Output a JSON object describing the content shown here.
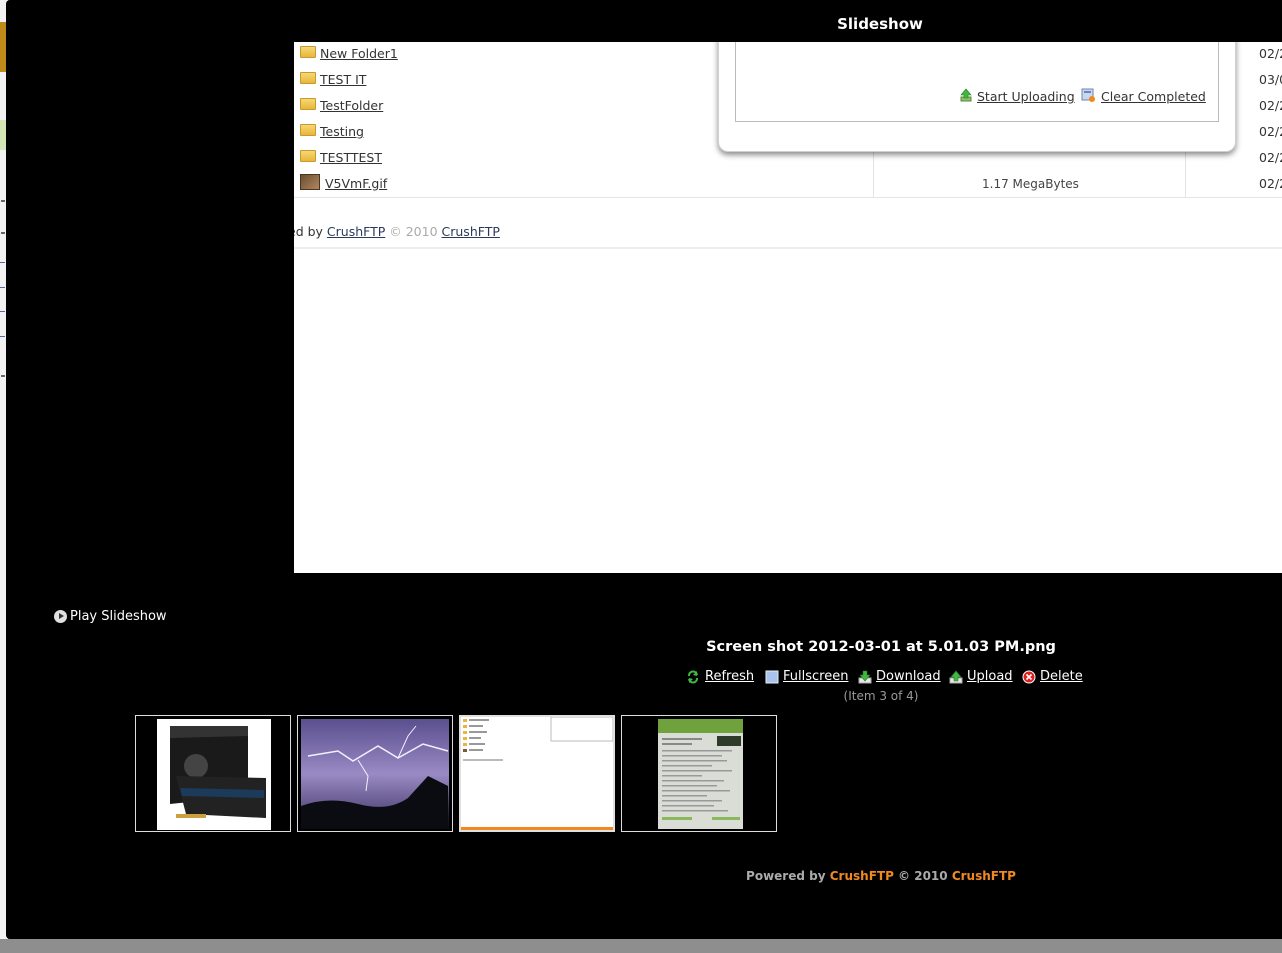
{
  "window": {
    "title": "Slideshow"
  },
  "file_list": [
    {
      "name": "New Folder1",
      "date": "02/2",
      "type": "folder"
    },
    {
      "name": "TEST IT",
      "date": "03/0",
      "type": "folder"
    },
    {
      "name": "TestFolder",
      "date": "02/2",
      "type": "folder"
    },
    {
      "name": "Testing",
      "date": "02/2",
      "type": "folder"
    },
    {
      "name": "TESTTEST",
      "date": "02/2",
      "type": "folder"
    },
    {
      "name": "V5VmF.gif",
      "size": "1.17 MegaBytes",
      "date": "02/2",
      "type": "image"
    }
  ],
  "upload_panel": {
    "start_label": "Start Uploading",
    "clear_label": "Clear Completed"
  },
  "inner_footer": {
    "prefix": "ed by ",
    "link1": "CrushFTP",
    "copy": " © 2010 ",
    "link2": "CrushFTP"
  },
  "slideshow": {
    "play_label": "Play Slideshow",
    "caption": "Screen shot 2012-03-01 at 5.01.03 PM.png",
    "actions": {
      "refresh": "Refresh",
      "fullscreen": "Fullscreen",
      "download": "Download",
      "upload": "Upload",
      "delete": "Delete"
    },
    "item_counter": "(Item 3 of 4)",
    "selected_index": 3,
    "thumbnails": [
      "graphics-card",
      "lightning-sky",
      "screenshot",
      "document-page"
    ]
  },
  "footer": {
    "prefix": "Powered by ",
    "brand1": "CrushFTP",
    "middle": " © 2010 ",
    "brand2": "CrushFTP"
  },
  "colors": {
    "background": "#000000",
    "brand_orange": "#f08a20",
    "link_gray": "#333333"
  }
}
